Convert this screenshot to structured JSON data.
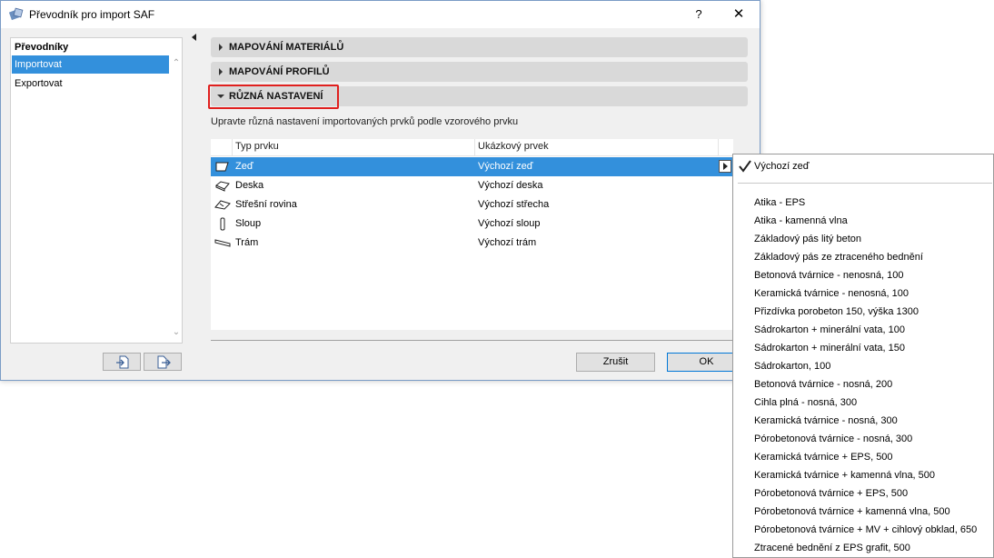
{
  "window": {
    "title": "Převodník pro import SAF",
    "help_label": "?",
    "close_label": "✕"
  },
  "sidebar": {
    "header": "Převodníky",
    "items": [
      {
        "label": "Importovat",
        "selected": true
      },
      {
        "label": "Exportovat",
        "selected": false
      }
    ]
  },
  "sections": [
    {
      "label": "MAPOVÁNÍ MATERIÁLŮ",
      "expanded": false
    },
    {
      "label": "MAPOVÁNÍ PROFILŮ",
      "expanded": false
    },
    {
      "label": "RŮZNÁ NASTAVENÍ",
      "expanded": true
    }
  ],
  "description": "Upravte různá nastavení importovaných prvků podle vzorového prvku",
  "table": {
    "columns": [
      "Typ prvku",
      "Ukázkový prvek"
    ],
    "rows": [
      {
        "type": "Zeď",
        "sample": "Výchozí zeď",
        "icon": "wall-icon",
        "selected": true
      },
      {
        "type": "Deska",
        "sample": "Výchozí deska",
        "icon": "slab-icon",
        "selected": false
      },
      {
        "type": "Střešní rovina",
        "sample": "Výchozí střecha",
        "icon": "roof-icon",
        "selected": false
      },
      {
        "type": "Sloup",
        "sample": "Výchozí sloup",
        "icon": "column-icon",
        "selected": false
      },
      {
        "type": "Trám",
        "sample": "Výchozí trám",
        "icon": "beam-icon",
        "selected": false
      }
    ]
  },
  "buttons": {
    "cancel": "Zrušit",
    "ok": "OK"
  },
  "dropdown": {
    "current": "Výchozí zeď",
    "options": [
      "Atika - EPS",
      "Atika - kamenná vlna",
      "Základový pás litý beton",
      "Základový pás ze ztraceného bednění",
      "Betonová tvárnice - nenosná, 100",
      "Keramická tvárnice - nenosná, 100",
      "Přizdívka porobeton 150, výška 1300",
      "Sádrokarton + minerální vata, 100",
      "Sádrokarton + minerální vata, 150",
      "Sádrokarton, 100",
      "Betonová tvárnice - nosná, 200",
      "Cihla plná - nosná, 300",
      "Keramická tvárnice - nosná, 300",
      "Pórobetonová tvárnice - nosná, 300",
      "Keramická tvárnice + EPS, 500",
      "Keramická tvárnice + kamenná vlna, 500",
      "Pórobetonová tvárnice + EPS, 500",
      "Pórobetonová tvárnice + kamenná vlna, 500",
      "Pórobetonová tvárnice + MV + cihlový obklad, 650",
      "Ztracené bednění z EPS grafit, 500"
    ]
  },
  "colors": {
    "selection": "#3390dc",
    "highlight_frame": "#e0201e",
    "section_bg": "#d9d9d9"
  }
}
